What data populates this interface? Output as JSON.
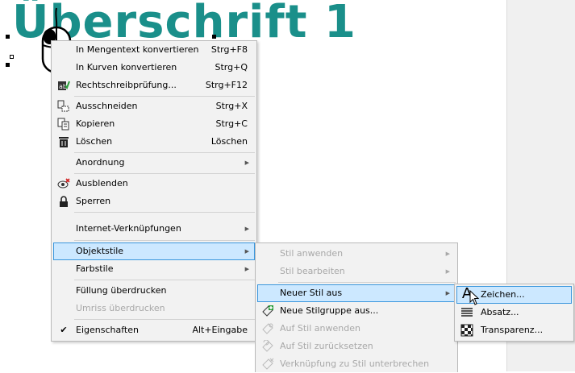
{
  "document": {
    "heading": "Überschrift 1"
  },
  "main_menu": {
    "items": [
      {
        "label": "In Mengentext konvertieren",
        "shortcut": "Strg+F8"
      },
      {
        "label": "In Kurven konvertieren",
        "shortcut": "Strg+Q"
      },
      {
        "label": "Rechtschreibprüfung...",
        "shortcut": "Strg+F12",
        "icon": "spellcheck-icon"
      },
      {
        "label": "Ausschneiden",
        "shortcut": "Strg+X",
        "icon": "cut-icon"
      },
      {
        "label": "Kopieren",
        "shortcut": "Strg+C",
        "icon": "copy-icon"
      },
      {
        "label": "Löschen",
        "shortcut": "Löschen",
        "icon": "trash-icon"
      },
      {
        "label": "Anordnung"
      },
      {
        "label": "Ausblenden",
        "icon": "hide-icon"
      },
      {
        "label": "Sperren",
        "icon": "lock-icon"
      },
      {
        "label": "Internet-Verknüpfungen"
      },
      {
        "label": "Objektstile"
      },
      {
        "label": "Farbstile"
      },
      {
        "label": "Füllung überdrucken"
      },
      {
        "label": "Umriss überdrucken"
      },
      {
        "label": "Eigenschaften",
        "shortcut": "Alt+Eingabe",
        "icon": "checkmark-icon"
      }
    ]
  },
  "styles_submenu": {
    "items": [
      {
        "label": "Stil anwenden"
      },
      {
        "label": "Stil bearbeiten"
      },
      {
        "label": "Neuer Stil aus"
      },
      {
        "label": "Neue Stilgruppe aus...",
        "icon": "new-style-group-icon"
      },
      {
        "label": "Auf Stil anwenden",
        "icon": "apply-to-style-icon"
      },
      {
        "label": "Auf Stil zurücksetzen",
        "icon": "revert-style-icon"
      },
      {
        "label": "Verknüpfung zu Stil unterbrechen",
        "icon": "break-link-icon"
      }
    ]
  },
  "new_style_submenu": {
    "items": [
      {
        "label": "Zeichen...",
        "icon": "character-style-icon"
      },
      {
        "label": "Absatz...",
        "icon": "paragraph-style-icon"
      },
      {
        "label": "Transparenz...",
        "icon": "transparency-style-icon"
      }
    ]
  },
  "colors": {
    "heading": "#1a8f8a",
    "highlight": "#cce8ff",
    "highlight_border": "#3a96dd",
    "menu_bg": "#f2f2f2",
    "disabled_text": "#a8a8a8"
  }
}
